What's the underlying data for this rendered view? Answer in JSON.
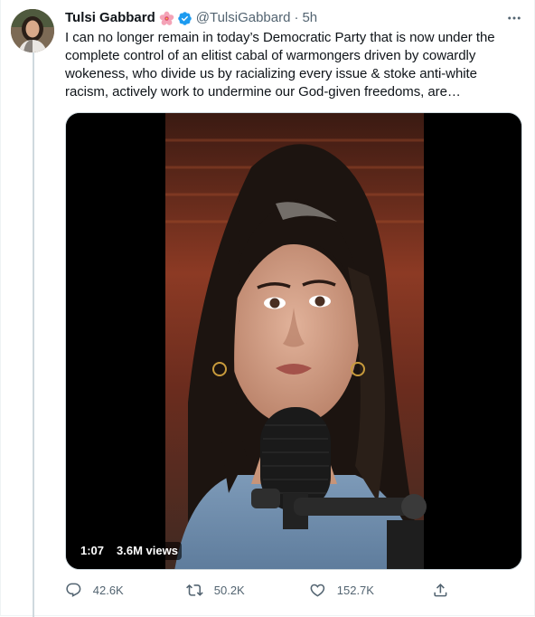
{
  "tweet": {
    "display_name": "Tulsi Gabbard",
    "handle": "@TulsiGabbard",
    "separator": "·",
    "time": "5h",
    "text": "I can no longer remain in today’s Democratic Party that is now under the complete control of an elitist cabal of warmongers driven by cowardly wokeness, who divide us by racializing every issue & stoke anti-white racism, actively work to undermine our God-given freedoms, are…",
    "icons": {
      "flower": "hibiscus-icon",
      "verified": "verified-badge-icon",
      "more": "more-options-icon"
    },
    "colors": {
      "verified": "#1d9bf0",
      "secondary_text": "#536471",
      "thread_line": "#cfd9de"
    }
  },
  "video": {
    "duration": "1:07",
    "views": "3.6M views"
  },
  "actions": {
    "replies": "42.6K",
    "retweets": "50.2K",
    "likes": "152.7K",
    "icons": [
      "reply-icon",
      "retweet-icon",
      "like-icon",
      "share-icon"
    ]
  }
}
